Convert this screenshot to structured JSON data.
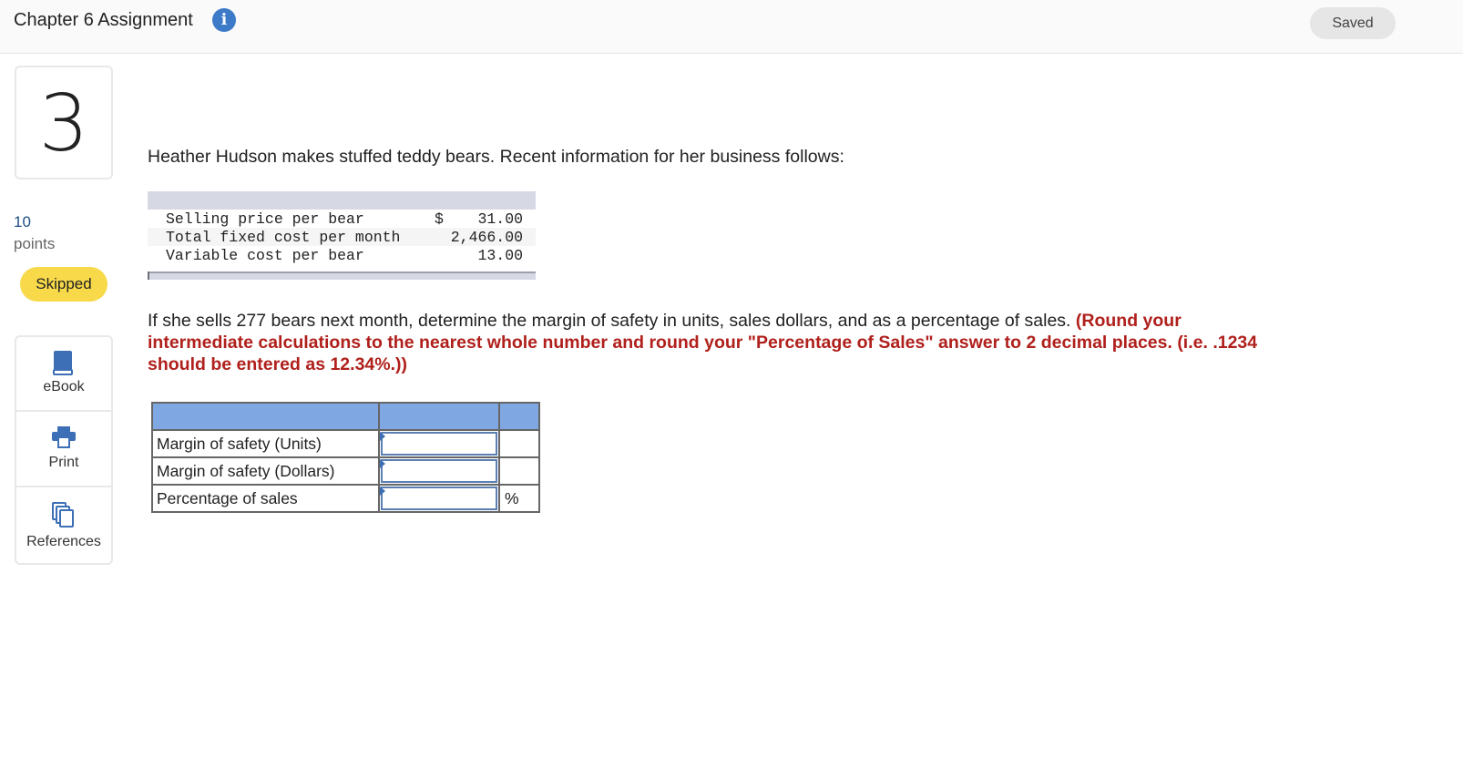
{
  "header": {
    "title": "Chapter 6 Assignment",
    "info_icon": "info-icon",
    "saved_label": "Saved"
  },
  "sidebar": {
    "question_number": "3",
    "points_value": "10",
    "points_label": "points",
    "status_badge": "Skipped",
    "tools": [
      {
        "label": "eBook",
        "icon": "book-icon"
      },
      {
        "label": "Print",
        "icon": "printer-icon"
      },
      {
        "label": "References",
        "icon": "copy-icon"
      }
    ]
  },
  "problem": {
    "intro": "Heather Hudson makes stuffed teddy bears. Recent information for her business follows:",
    "given_table": [
      {
        "label": "Selling price per bear",
        "currency": "$",
        "amount": "31.00"
      },
      {
        "label": "Total fixed cost per month",
        "currency": "",
        "amount": "2,466.00"
      },
      {
        "label": "Variable cost per bear",
        "currency": "",
        "amount": "13.00"
      }
    ],
    "question_text": "If she sells 277 bears next month, determine the margin of safety in units, sales dollars, and as a percentage of sales.",
    "instruction_text": "(Round your intermediate calculations to the nearest whole number and round your \"Percentage of Sales\" answer to 2 decimal places. (i.e. .1234 should be entered as 12.34%.))"
  },
  "answer_table": {
    "header_color": "#7fa8e3",
    "rows": [
      {
        "label": "Margin of safety (Units)",
        "value": "",
        "unit": ""
      },
      {
        "label": "Margin of safety (Dollars)",
        "value": "",
        "unit": ""
      },
      {
        "label": "Percentage of sales",
        "value": "",
        "unit": "%"
      }
    ]
  },
  "colors": {
    "instruction_red": "#b0201c",
    "skipped_badge": "#f7d94a",
    "info_blue": "#3d7ac8",
    "tool_icon_blue": "#3d6fb6"
  }
}
